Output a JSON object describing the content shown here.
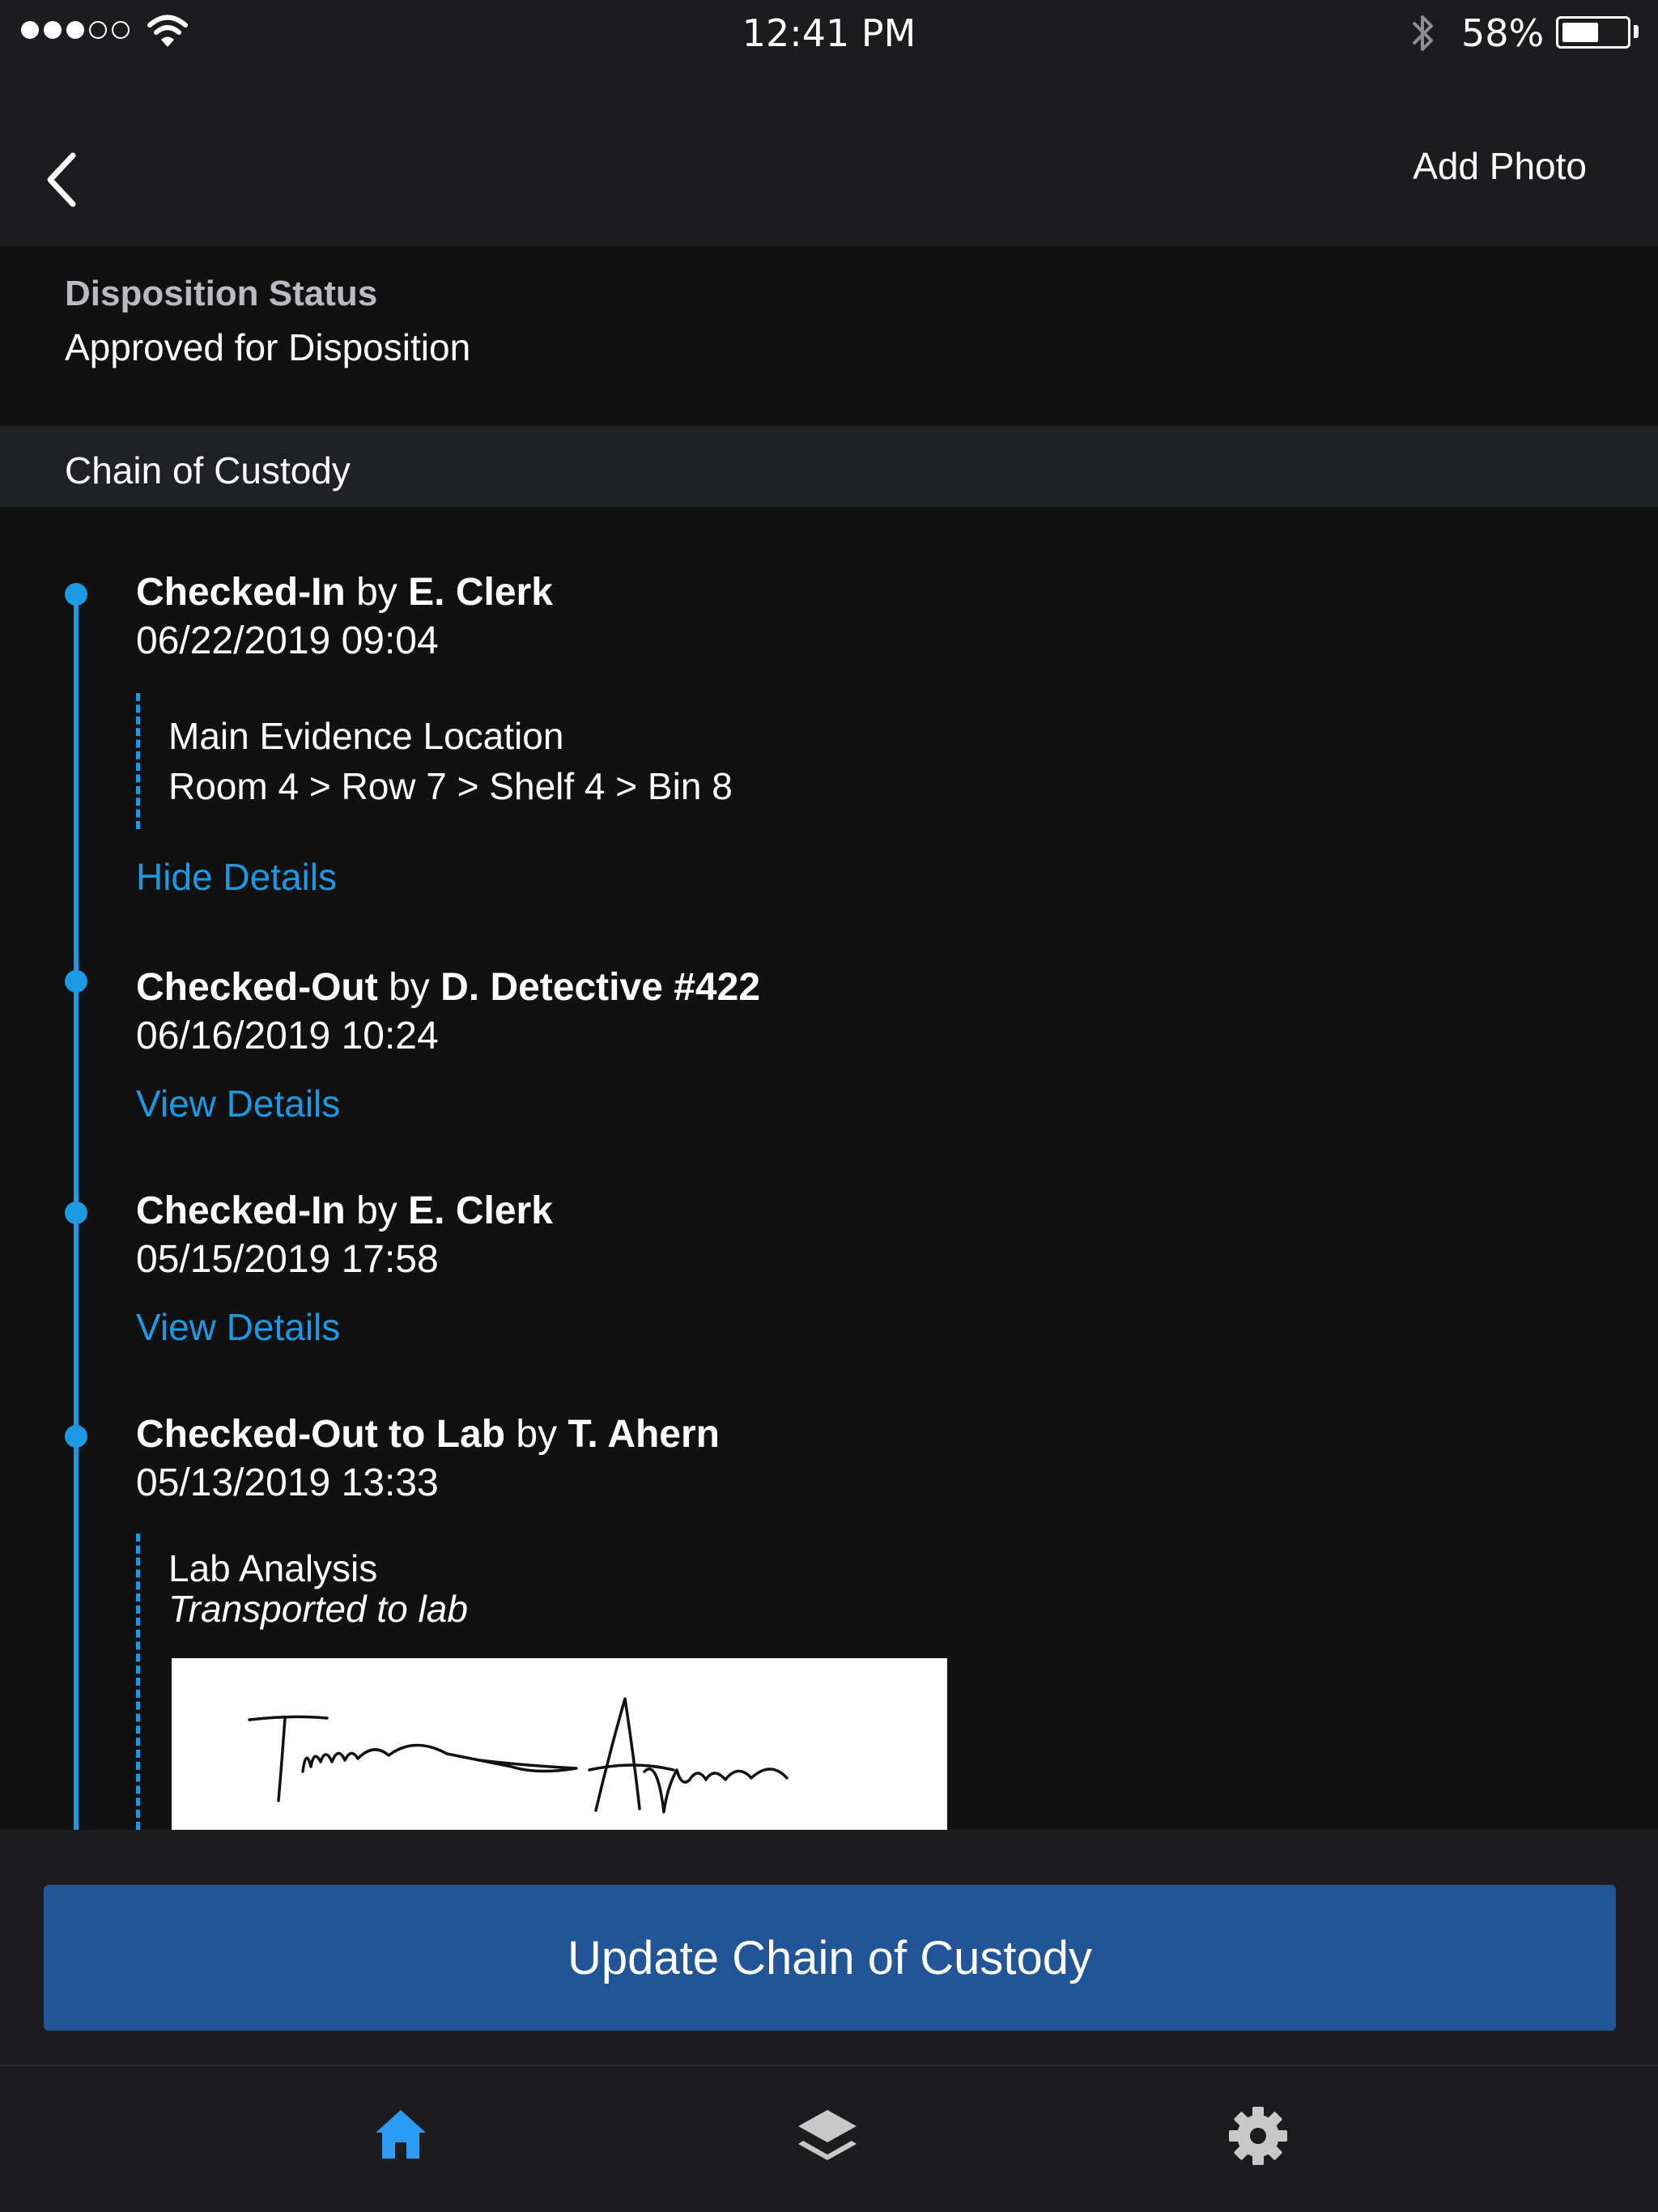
{
  "status_bar": {
    "time": "12:41 PM",
    "battery_percent": "58%",
    "battery_level": 0.58,
    "signal_bars_filled": 3,
    "signal_bars_total": 5,
    "icons": [
      "wifi-icon",
      "bluetooth-icon",
      "battery-icon"
    ]
  },
  "nav": {
    "back_icon": "chevron-left-icon",
    "add_photo_label": "Add Photo"
  },
  "disposition": {
    "label": "Disposition Status",
    "value": "Approved for Disposition"
  },
  "chain": {
    "section_title": "Chain of Custody",
    "events": [
      {
        "action": "Checked-In",
        "by_word": "by",
        "person": "E. Clerk",
        "datetime": "06/22/2019  09:04",
        "detail_line1": "Main Evidence Location",
        "detail_line2": "Room 4 > Row 7 > Shelf 4 > Bin 8",
        "link": "Hide Details"
      },
      {
        "action": "Checked-Out",
        "by_word": "by",
        "person": "D. Detective #422",
        "datetime": "06/16/2019  10:24",
        "link": "View Details"
      },
      {
        "action": "Checked-In",
        "by_word": "by",
        "person": "E. Clerk",
        "datetime": "05/15/2019  17:58",
        "link": "View Details"
      },
      {
        "action": "Checked-Out to Lab",
        "by_word": "by",
        "person": "T. Ahern",
        "datetime": "05/13/2019  13:33",
        "detail_line1": "Lab Analysis",
        "detail_line2": "Transported to lab",
        "signature_name": "T. Ahern"
      }
    ]
  },
  "actions": {
    "update_label": "Update Chain of Custody"
  },
  "tabbar": {
    "items": [
      {
        "icon": "home-icon",
        "active": true
      },
      {
        "icon": "layers-icon",
        "active": false
      },
      {
        "icon": "gear-icon",
        "active": false
      }
    ],
    "active_color": "#2b9af3",
    "inactive_color": "#c8c8c8"
  },
  "colors": {
    "accent": "#1b9ae3",
    "button": "#225598",
    "background": "#111112",
    "bar": "#1c1c1e"
  }
}
